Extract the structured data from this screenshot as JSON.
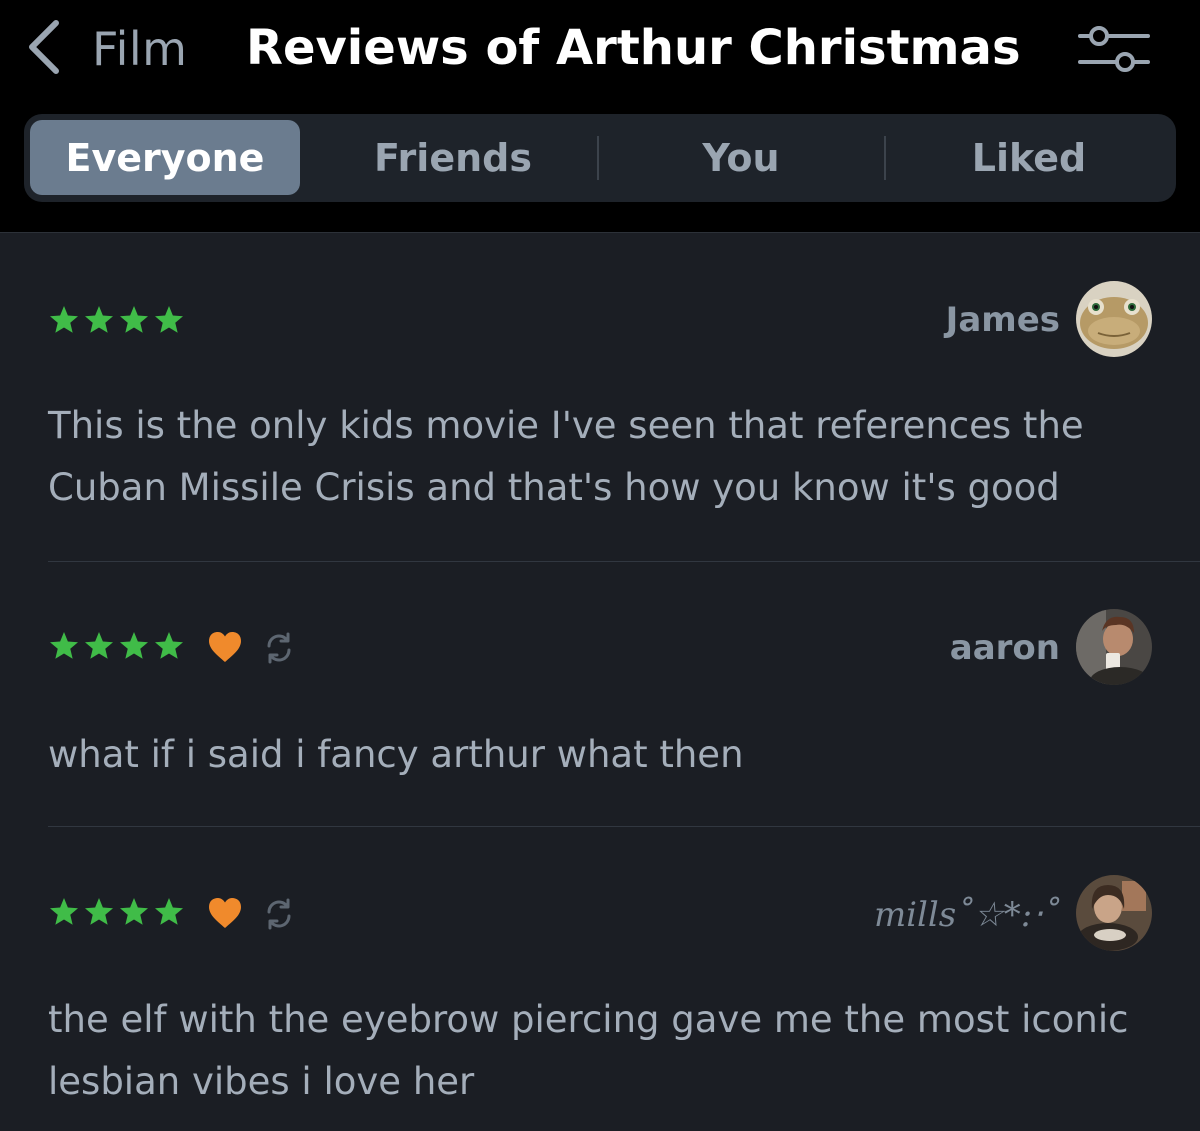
{
  "header": {
    "back_label": "Film",
    "title": "Reviews of Arthur Christmas",
    "back_icon": "chevron-left-icon",
    "filter_icon": "sliders-icon"
  },
  "tabs": [
    {
      "label": "Everyone",
      "active": true
    },
    {
      "label": "Friends",
      "active": false
    },
    {
      "label": "You",
      "active": false
    },
    {
      "label": "Liked",
      "active": false
    }
  ],
  "colors": {
    "star": "#40bc48",
    "heart": "#f08a2c",
    "active_tab": "#6b7c8f",
    "background": "#1b1e24"
  },
  "reviews": [
    {
      "user": "James",
      "rating": 4,
      "liked": false,
      "rewatch": false,
      "text": "This is the only kids movie I've seen that references the Cuban Missile Crisis and that's how you know it's good"
    },
    {
      "user": "aaron",
      "rating": 4,
      "liked": true,
      "rewatch": true,
      "text": "what if i said i fancy arthur what then"
    },
    {
      "user": "mills˚☆*:‧˚",
      "rating": 4,
      "liked": true,
      "rewatch": true,
      "text": "the elf with the eyebrow piercing gave me the most iconic lesbian vibes i love her"
    }
  ]
}
